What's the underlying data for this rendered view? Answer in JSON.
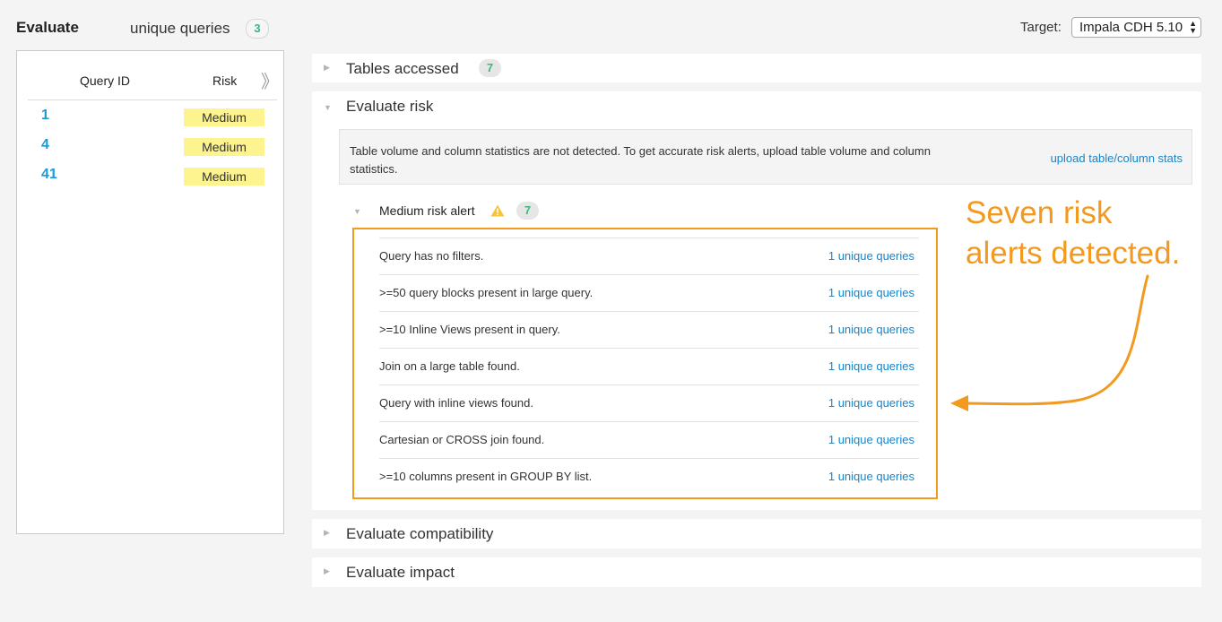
{
  "header": {
    "title": "Evaluate",
    "unique_queries_label": "unique queries",
    "unique_queries_count": "3",
    "target_label": "Target:",
    "target_value": "Impala CDH 5.10"
  },
  "query_list": {
    "col_query_id": "Query ID",
    "col_risk": "Risk",
    "rows": [
      {
        "id": "1",
        "risk": "Medium"
      },
      {
        "id": "4",
        "risk": "Medium"
      },
      {
        "id": "41",
        "risk": "Medium"
      }
    ]
  },
  "sections": {
    "tables_accessed": {
      "title": "Tables accessed",
      "count": "7"
    },
    "evaluate_risk": {
      "title": "Evaluate risk",
      "notice": "Table volume and column statistics are not detected. To get accurate risk alerts, upload table volume and column statistics.",
      "upload_link": "upload table/column stats",
      "alert_group": {
        "title": "Medium risk alert",
        "count": "7",
        "alerts": [
          {
            "text": "Query has no filters.",
            "link": "1 unique queries"
          },
          {
            "text": ">=50 query blocks present in large query.",
            "link": "1 unique queries"
          },
          {
            "text": ">=10 Inline Views present in query.",
            "link": "1 unique queries"
          },
          {
            "text": "Join on a large table found.",
            "link": "1 unique queries"
          },
          {
            "text": "Query with inline views found.",
            "link": "1 unique queries"
          },
          {
            "text": "Cartesian or CROSS join found.",
            "link": "1 unique queries"
          },
          {
            "text": ">=10 columns present in GROUP BY list.",
            "link": "1 unique queries"
          }
        ]
      }
    },
    "evaluate_compatibility": {
      "title": "Evaluate compatibility"
    },
    "evaluate_impact": {
      "title": "Evaluate impact"
    }
  },
  "annotation": {
    "line1": "Seven risk",
    "line2": "alerts detected."
  },
  "colors": {
    "accent_orange": "#f39a1e",
    "link_blue": "#1a84c9",
    "id_blue": "#1a9bd7",
    "badge_green": "#3ab67c",
    "risk_yellow": "#fdf38f"
  },
  "icons": [
    "collapse-double-chevron-icon",
    "caret-right-icon",
    "caret-down-icon",
    "warning-triangle-icon",
    "select-arrows-icon"
  ]
}
